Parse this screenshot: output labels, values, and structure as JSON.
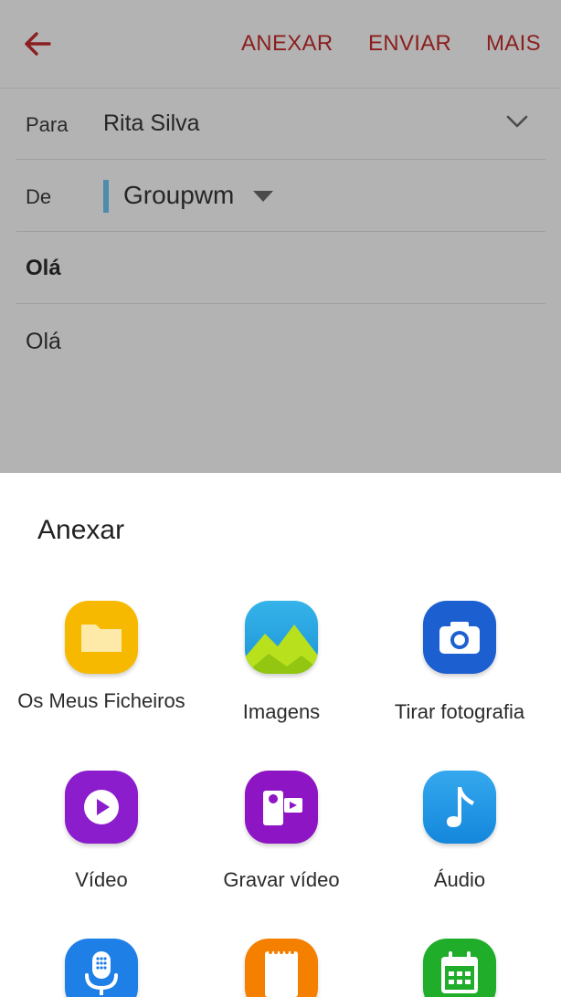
{
  "toolbar": {
    "back_icon": "arrow-left-icon",
    "attach_label": "ANEXAR",
    "send_label": "ENVIAR",
    "more_label": "MAIS",
    "accent_color": "#8b1f1f"
  },
  "compose": {
    "to_label": "Para",
    "to_value": "Rita Silva",
    "from_label": "De",
    "from_value": "Groupwm",
    "subject": "Olá",
    "body": "Olá"
  },
  "sheet": {
    "title": "Anexar",
    "items": [
      {
        "label": "Os Meus Ficheiros",
        "icon": "folder-icon",
        "color": "#f5b800"
      },
      {
        "label": "Imagens",
        "icon": "image-icon",
        "color": "#2aa8e0"
      },
      {
        "label": "Tirar fotografia",
        "icon": "camera-icon",
        "color": "#1a5fd0"
      },
      {
        "label": "Vídeo",
        "icon": "play-icon",
        "color": "#8a1ccc"
      },
      {
        "label": "Gravar vídeo",
        "icon": "video-camera-icon",
        "color": "#8d14c2"
      },
      {
        "label": "Áudio",
        "icon": "music-note-icon",
        "color": "#1a8fe0"
      },
      {
        "label": "",
        "icon": "microphone-icon",
        "color": "#1e7ee6"
      },
      {
        "label": "",
        "icon": "notepad-icon",
        "color": "#f57f00"
      },
      {
        "label": "",
        "icon": "calendar-icon",
        "color": "#1fae2a"
      }
    ]
  }
}
